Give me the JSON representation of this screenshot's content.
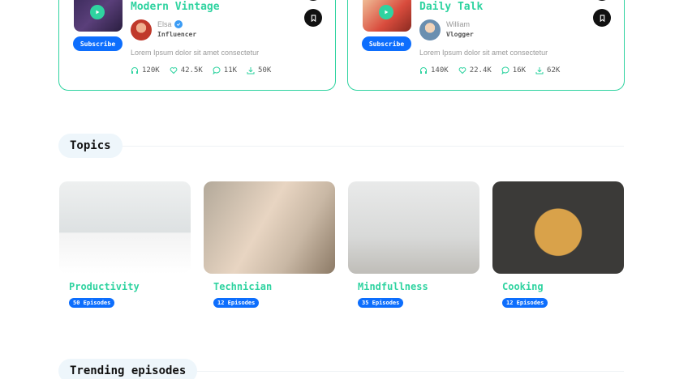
{
  "podcasts": [
    {
      "title": "Modern Vintage",
      "author": "Elsa",
      "verified": true,
      "role": "Influencer",
      "subscribe_label": "Subscribe",
      "description": "Lorem Ipsum dolor sit amet consectetur",
      "stats": {
        "listens": "120K",
        "likes": "42.5K",
        "comments": "11K",
        "downloads": "50K"
      }
    },
    {
      "title": "Daily Talk",
      "author": "William",
      "verified": false,
      "role": "Vlogger",
      "subscribe_label": "Subscribe",
      "description": "Lorem Ipsum dolor sit amet consectetur",
      "stats": {
        "listens": "140K",
        "likes": "22.4K",
        "comments": "16K",
        "downloads": "62K"
      }
    }
  ],
  "topics_section": {
    "heading": "Topics"
  },
  "topics": [
    {
      "name": "Productivity",
      "episodes": "50 Episodes"
    },
    {
      "name": "Technician",
      "episodes": "12 Episodes"
    },
    {
      "name": "Mindfullness",
      "episodes": "35 Episodes"
    },
    {
      "name": "Cooking",
      "episodes": "12 Episodes"
    }
  ],
  "trending_section": {
    "heading": "Trending episodes"
  },
  "icons": {
    "play": "play-icon",
    "bookmark": "bookmark-icon",
    "verified": "verified-check-icon",
    "listens": "headphones-icon",
    "likes": "heart-icon",
    "comments": "comment-icon",
    "downloads": "download-icon"
  },
  "colors": {
    "accent": "#2fd3a0",
    "primary": "#0d6efd",
    "dark": "#111111"
  }
}
